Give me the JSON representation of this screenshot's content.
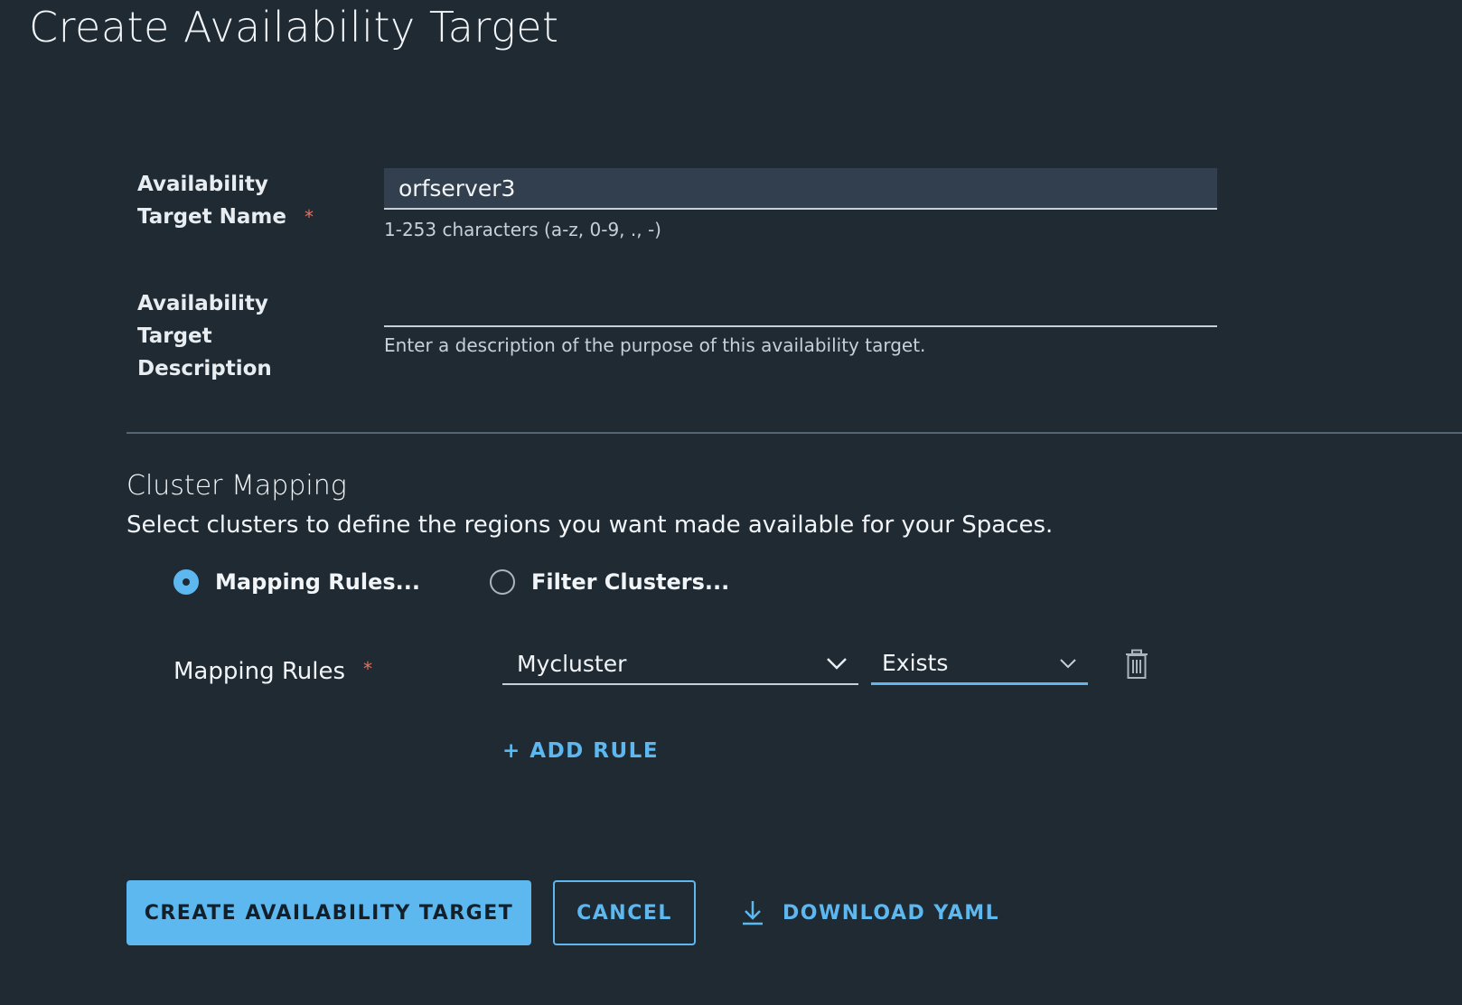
{
  "page": {
    "title": "Create Availability Target"
  },
  "form": {
    "name_field": {
      "label_line1": "Availability",
      "label_line2": "Target Name",
      "required_mark": "*",
      "value": "orfserver3",
      "helper": "1-253 characters (a-z, 0-9, ., -)"
    },
    "description_field": {
      "label_line1": "Availability",
      "label_line2": "Target",
      "label_line3": "Description",
      "value": "",
      "helper": "Enter a description of the purpose of this availability target."
    }
  },
  "cluster_mapping": {
    "title": "Cluster Mapping",
    "subtitle": "Select clusters to define the regions you want made available for your Spaces.",
    "options": [
      {
        "label": "Mapping Rules...",
        "checked": true
      },
      {
        "label": "Filter Clusters...",
        "checked": false
      }
    ],
    "rules_label": "Mapping Rules",
    "required_mark": "*",
    "rule": {
      "cluster": "Mycluster",
      "operator": "Exists"
    },
    "add_rule_label": "+ ADD RULE"
  },
  "actions": {
    "create_label": "CREATE AVAILABILITY TARGET",
    "cancel_label": "CANCEL",
    "download_label": "DOWNLOAD YAML"
  },
  "colors": {
    "background": "#1f2a33",
    "accent": "#5db8f0",
    "required": "#e8715c",
    "input_fill": "#323f4e"
  },
  "icons": {
    "cluster_dropdown": "chevron-down-icon",
    "operator_dropdown": "chevron-down-icon",
    "delete_rule": "trash-icon",
    "download": "download-icon"
  }
}
